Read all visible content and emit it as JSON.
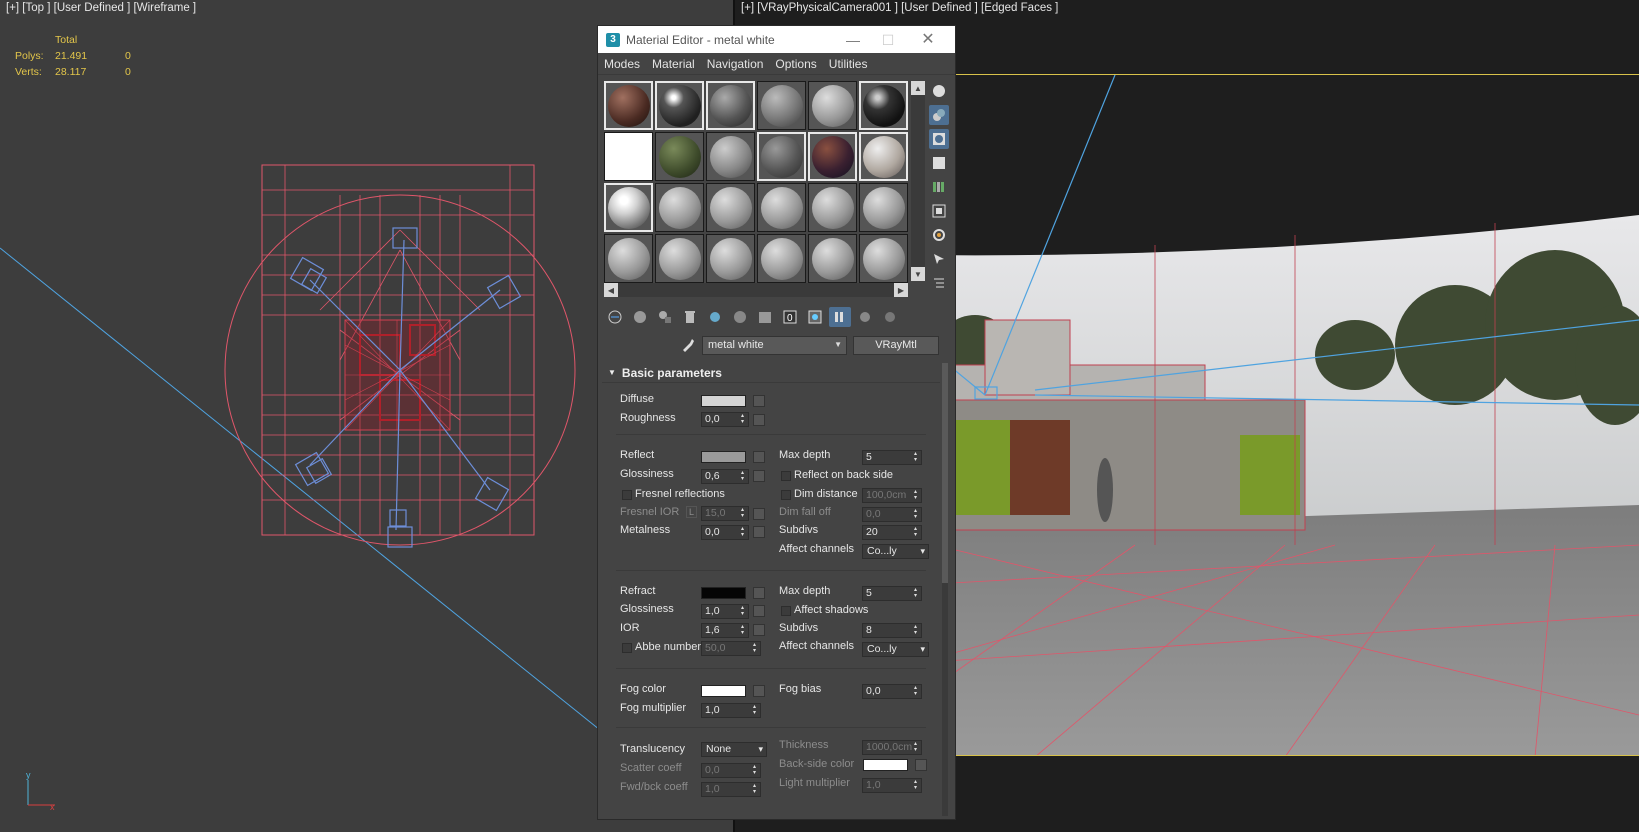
{
  "viewport_left": {
    "label": "[+] [Top ] [User Defined ] [Wireframe ]",
    "stats": {
      "header": "Total",
      "polys_label": "Polys:",
      "polys_value": "21.491",
      "polys_sel": "0",
      "verts_label": "Verts:",
      "verts_value": "28.117",
      "verts_sel": "0"
    }
  },
  "viewport_right": {
    "label": "[+] [VRayPhysicalCamera001 ] [User Defined ] [Edged Faces ]"
  },
  "material_editor": {
    "title": "Material Editor - metal white",
    "app_icon": "3",
    "menu": [
      "Modes",
      "Material",
      "Navigation",
      "Options",
      "Utilities"
    ],
    "material_name": "metal white",
    "material_type": "VRayMtl",
    "rollout_title": "Basic parameters",
    "diffuse": {
      "label": "Diffuse",
      "color": "#d4d4d4"
    },
    "roughness": {
      "label": "Roughness",
      "value": "0,0"
    },
    "reflect": {
      "label": "Reflect",
      "color": "#9a9a9a"
    },
    "refl_glossiness": {
      "label": "Glossiness",
      "value": "0,6"
    },
    "fresnel": {
      "label": "Fresnel reflections"
    },
    "fresnel_ior": {
      "label": "Fresnel IOR",
      "lock": "L",
      "value": "15,0"
    },
    "metalness": {
      "label": "Metalness",
      "value": "0,0"
    },
    "refl_max_depth": {
      "label": "Max depth",
      "value": "5"
    },
    "reflect_back": {
      "label": "Reflect on back side"
    },
    "dim_distance": {
      "label": "Dim distance",
      "value": "100,0cm"
    },
    "dim_falloff": {
      "label": "Dim fall off",
      "value": "0,0"
    },
    "refl_subdivs": {
      "label": "Subdivs",
      "value": "20"
    },
    "refl_affect": {
      "label": "Affect channels",
      "value": "Co...ly"
    },
    "refract": {
      "label": "Refract",
      "color": "#050505"
    },
    "refr_glossiness": {
      "label": "Glossiness",
      "value": "1,0"
    },
    "ior": {
      "label": "IOR",
      "value": "1,6"
    },
    "abbe": {
      "label": "Abbe number",
      "value": "50,0"
    },
    "refr_max_depth": {
      "label": "Max depth",
      "value": "5"
    },
    "affect_shadows": {
      "label": "Affect shadows"
    },
    "refr_subdivs": {
      "label": "Subdivs",
      "value": "8"
    },
    "refr_affect": {
      "label": "Affect channels",
      "value": "Co...ly"
    },
    "fog_color": {
      "label": "Fog color",
      "color": "#ffffff"
    },
    "fog_multiplier": {
      "label": "Fog multiplier",
      "value": "1,0"
    },
    "fog_bias": {
      "label": "Fog bias",
      "value": "0,0"
    },
    "translucency": {
      "label": "Translucency",
      "value": "None"
    },
    "scatter": {
      "label": "Scatter coeff",
      "value": "0,0"
    },
    "fwd_bck": {
      "label": "Fwd/bck coeff",
      "value": "1,0"
    },
    "thickness": {
      "label": "Thickness",
      "value": "1000,0cm"
    },
    "backside_color": {
      "label": "Back-side color",
      "color": "#ffffff"
    },
    "light_mult": {
      "label": "Light multiplier",
      "value": "1,0"
    }
  },
  "colors": {
    "accent_active": "#4d6f92",
    "stats_text": "#e3c64a",
    "wire_red": "#e0566a",
    "wire_blue": "#6d8ed8",
    "camera_line": "#4fa3e0"
  }
}
